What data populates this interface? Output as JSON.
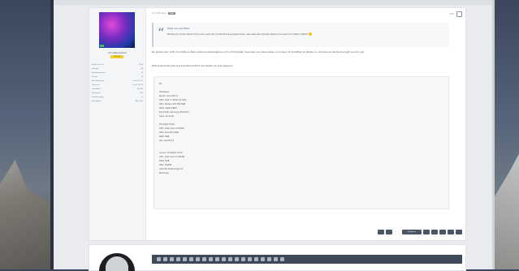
{
  "post": {
    "meta": "Vor 2 Minuten",
    "new_badge": "Neu",
    "post_number": "#30",
    "author": {
      "name": "ChrisNeuSeiten",
      "rank": "Vertraut",
      "stats": [
        {
          "label": "Registriert seit",
          "value": "2013"
        },
        {
          "label": "Beiträge",
          "value": "48"
        },
        {
          "label": "Reaktionspunkte",
          "value": "22"
        },
        {
          "label": "Punkte",
          "value": "16"
        },
        {
          "label": "Betriebssystem",
          "value": "macOS 13.0"
        },
        {
          "label": "Prozessor",
          "value": "Core i7-4790"
        },
        {
          "label": "Grafikkarte",
          "value": "RX 580"
        },
        {
          "label": "Mainboard",
          "value": "Z97"
        },
        {
          "label": "Pro Homepage",
          "value": "Ja"
        },
        {
          "label": "Mac Modell",
          "value": "iMac 18,3"
        }
      ]
    },
    "quote": {
      "header": "Zitat von nechtfox",
      "text": "Mit Kenyon ist der Ablauf doch schon auch bei macOS Ventura angekommen, was wäre das nächste System und was ihr zu Testen hattet?",
      "has_smiley": true
    },
    "para1": "Bin gerade dran, hoffe ich schaffe es. Beim Ventura Update klappt es noch nicht komplett, muss aber noch etwas testen und schaue mir bis Mittag die Tastatur an. Ich denke an den Rechner geht es schon gut.",
    "para2": "BIOS Ventura bald gibt es ja keine Nachricht für das Update, bin sehr gespannt.",
    "spoiler_lines": [
      "PC:",
      "",
      "Hardware:",
      "Board: Asus Z97-A",
      "CPU: Intel i7 4790 3,6 GHz",
      "GPU: Radeon RX 580 8GB",
      "RAM: 16GB DDR3",
      "Boot SSD: Samsung 850 EVO",
      "Case: be quiet",
      "",
      "ThinkPad T440:",
      "CPU: Intel Core i5-4300U",
      "GPU: Intel HD 4400",
      "RAM: 8GB",
      "OS: macOS 12",
      "",
      "",
      "Lenovo ThinkPad X230",
      "CPU: Intel Core i5-3320M",
      "RAM: 8GB",
      "SSD: 240GB",
      "Intel HD 4000 Graphics",
      "Monterey"
    ],
    "action_labels": [
      "Reagieren",
      "Zitieren",
      "Antworten"
    ]
  },
  "editor_toolbar_icons": [
    "bold-icon",
    "italic-icon",
    "underline-icon",
    "strike-icon",
    "color-icon",
    "font-icon",
    "size-icon",
    "link-icon",
    "image-icon",
    "media-icon",
    "quote-icon",
    "code-icon",
    "list-icon",
    "align-icon",
    "table-icon",
    "smiley-icon",
    "undo-icon",
    "redo-icon",
    "preview-icon",
    "settings-icon"
  ]
}
